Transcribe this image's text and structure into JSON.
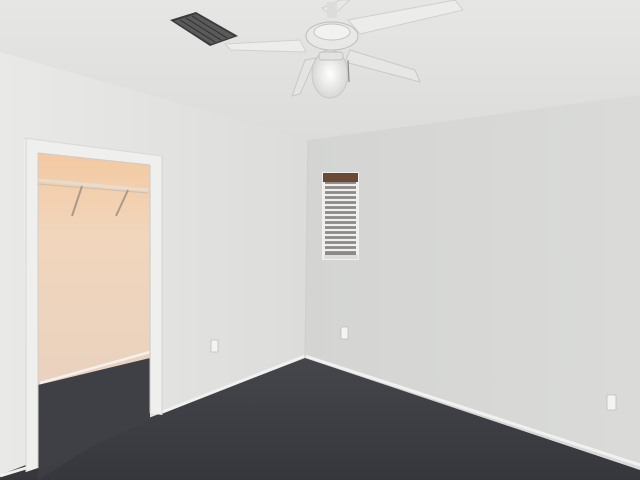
{
  "scene": {
    "description_kind": "photo",
    "room": "empty bedroom",
    "elements": [
      "ceiling",
      "ceiling-fan",
      "air-vent",
      "left-wall",
      "right-wall",
      "closet-doorway",
      "walk-in-closet",
      "window-with-blinds",
      "outlets",
      "baseboards",
      "carpet-floor"
    ],
    "colors": {
      "ceiling": "#e9e9e7",
      "left_wall": "#e2e2e0",
      "right_wall": "#d6d7d5",
      "closet_wall": "#f0d4b8",
      "carpet": "#3b3c42",
      "trim": "#efefed",
      "window_frame": "#6a4a36"
    }
  }
}
